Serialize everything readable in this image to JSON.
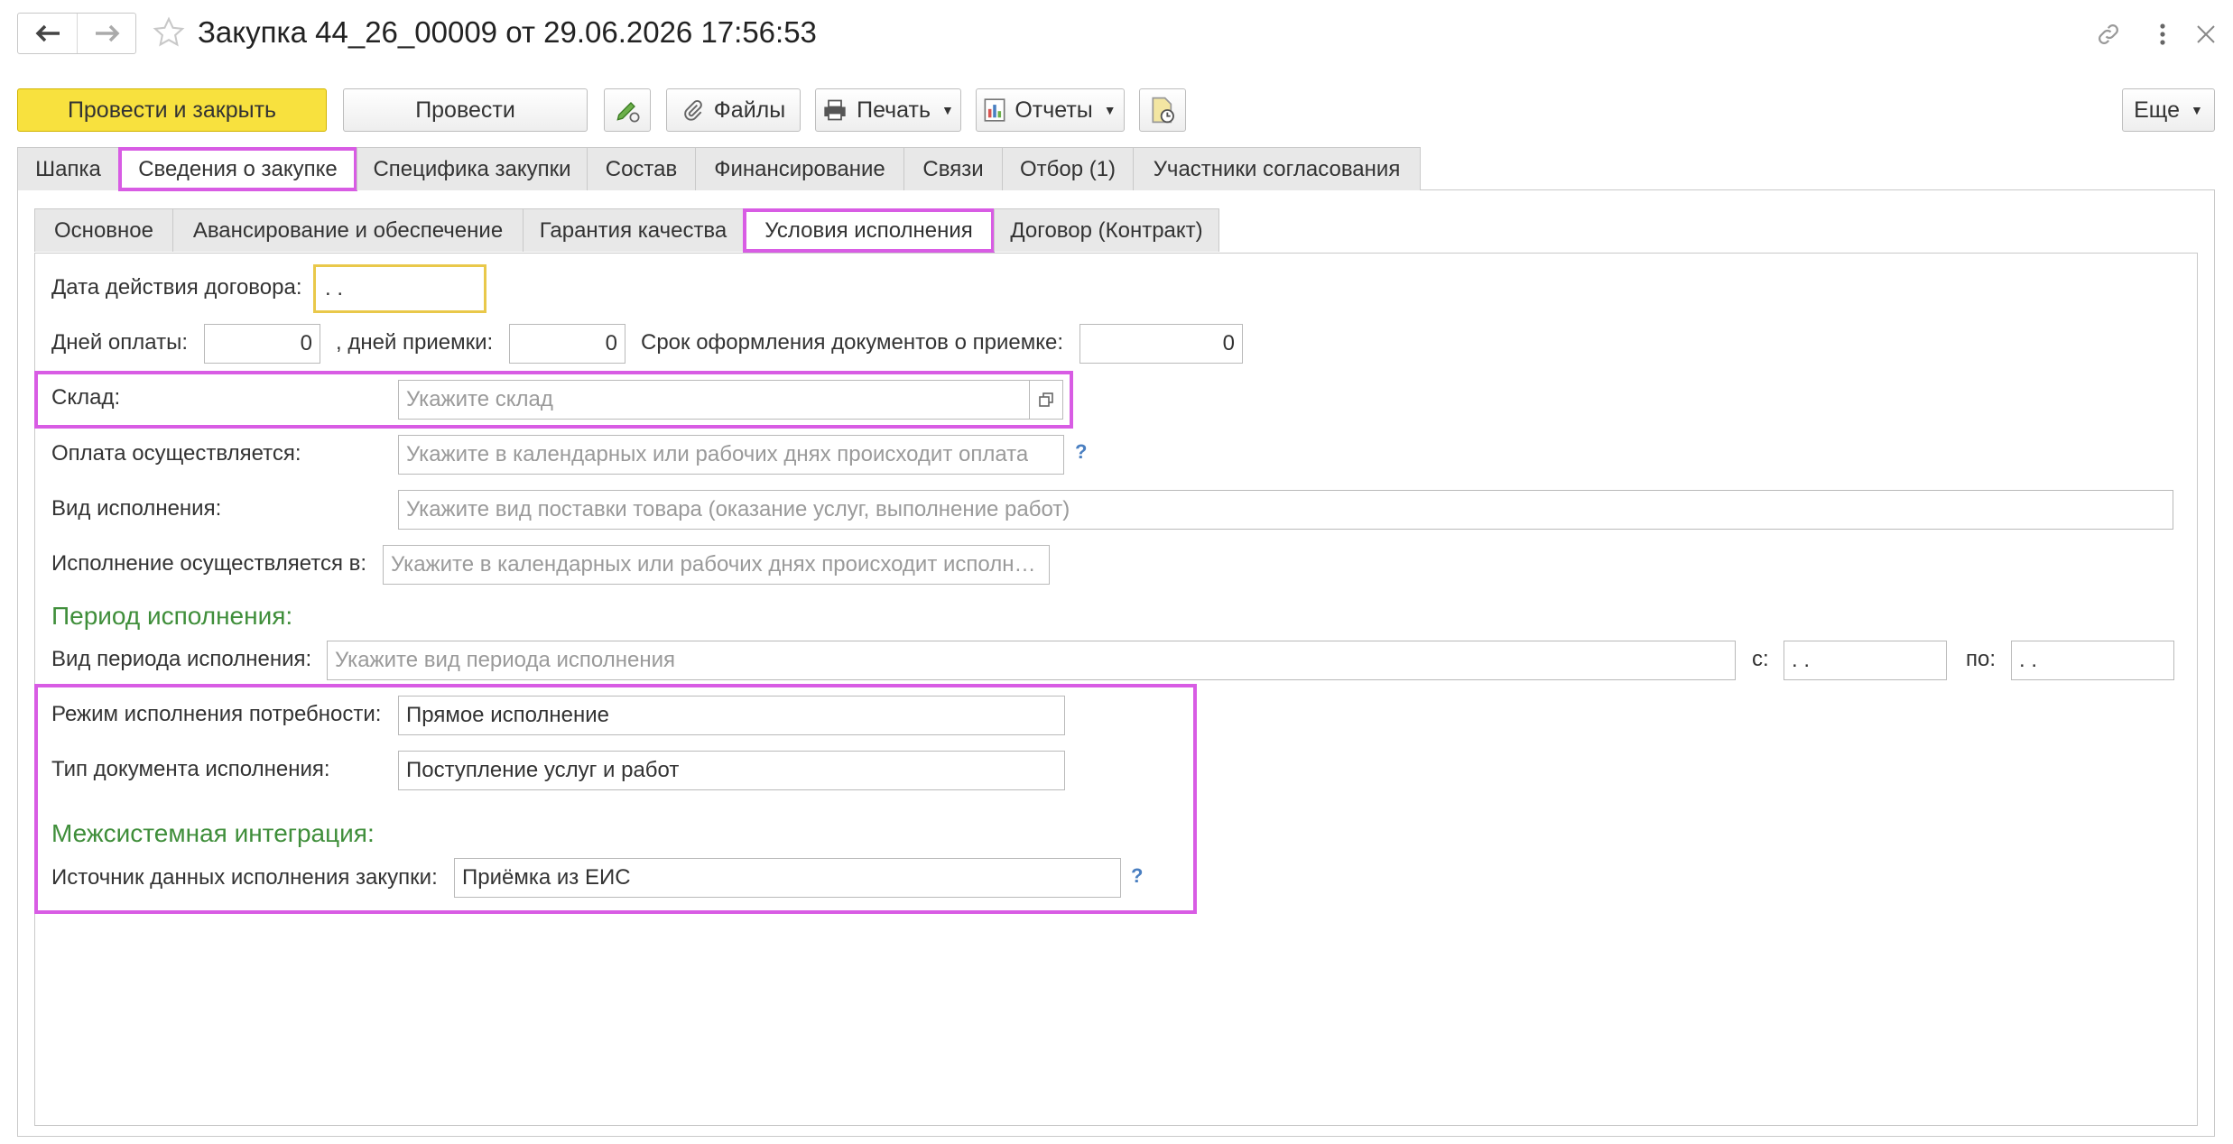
{
  "header": {
    "title": "Закупка 44_26_00009 от 29.06.2026 17:56:53"
  },
  "toolbar": {
    "post_and_close": "Провести и закрыть",
    "post": "Провести",
    "files": "Файлы",
    "print": "Печать",
    "reports": "Отчеты",
    "more": "Еще"
  },
  "tabs": [
    {
      "label": "Шапка"
    },
    {
      "label": "Сведения о закупке"
    },
    {
      "label": "Специфика закупки"
    },
    {
      "label": "Состав"
    },
    {
      "label": "Финансирование"
    },
    {
      "label": "Связи"
    },
    {
      "label": "Отбор (1)"
    },
    {
      "label": "Участники согласования"
    }
  ],
  "subtabs": [
    {
      "label": "Основное"
    },
    {
      "label": "Авансирование и обеспечение"
    },
    {
      "label": "Гарантия качества"
    },
    {
      "label": "Условия исполнения"
    },
    {
      "label": "Договор (Контракт)"
    }
  ],
  "form": {
    "contract_date_label": "Дата действия договора:",
    "contract_date_value": " .  .",
    "payment_days_label": "Дней оплаты:",
    "payment_days_value": "0",
    "acceptance_days_label": ", дней приемки:",
    "acceptance_days_value": "0",
    "doc_term_label": "Срок оформления документов о приемке:",
    "doc_term_value": "0",
    "warehouse_label": "Склад:",
    "warehouse_placeholder": "Укажите склад",
    "payment_mode_label": "Оплата осуществляется:",
    "payment_mode_placeholder": "Укажите в календарных или рабочих днях происходит оплата",
    "execution_kind_label": "Вид исполнения:",
    "execution_kind_placeholder": "Укажите вид поставки товара (оказание услуг, выполнение работ)",
    "execution_in_label": "Исполнение осуществляется в:",
    "execution_in_placeholder": "Укажите в календарных или рабочих днях происходит исполн…",
    "period_section": "Период исполнения:",
    "period_kind_label": "Вид периода исполнения:",
    "period_kind_placeholder": "Укажите вид периода исполнения",
    "from_label": "с:",
    "from_value": " .  .",
    "to_label": "по:",
    "to_value": " .  .",
    "need_mode_label": "Режим исполнения потребности:",
    "need_mode_value": "Прямое исполнение",
    "doc_type_label": "Тип документа исполнения:",
    "doc_type_value": "Поступление услуг и работ",
    "integration_section": "Межсистемная интеграция:",
    "source_label": "Источник данных исполнения закупки:",
    "source_value": "Приёмка из ЕИС",
    "help_mark": "?"
  }
}
